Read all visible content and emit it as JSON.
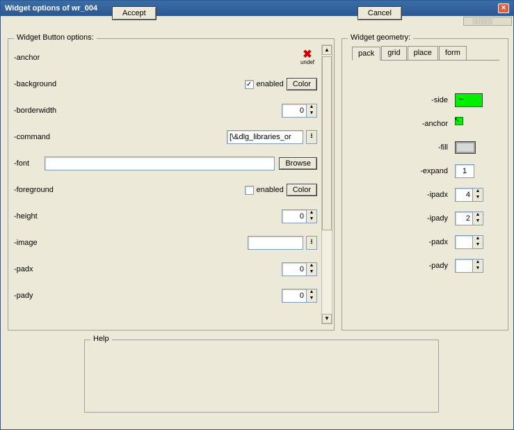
{
  "window": {
    "title": "Widget options of wr_004"
  },
  "buttonOptions": {
    "legend": "Widget Button options:",
    "rows": {
      "anchor": "-anchor",
      "background": "-background",
      "borderwidth": "-borderwidth",
      "command": "-command",
      "font": "-font",
      "foreground": "-foreground",
      "height": "-height",
      "image": "-image",
      "padx": "-padx",
      "pady": "-pady"
    },
    "undef_label": "undef",
    "enabled_label": "enabled",
    "color_btn": "Color",
    "browse_btn": "Browse",
    "values": {
      "background_enabled": true,
      "borderwidth": "0",
      "command": "[\\&dlg_libraries_or",
      "font": "",
      "foreground_enabled": false,
      "height": "0",
      "image": "",
      "padx": "0",
      "pady": "0"
    }
  },
  "geometry": {
    "legend": "Widget geometry:",
    "tabs": [
      "pack",
      "grid",
      "place",
      "form"
    ],
    "active_tab": "pack",
    "rows": {
      "side": "-side",
      "anchor": "-anchor",
      "fill": "-fill",
      "expand": "-expand",
      "ipadx": "-ipadx",
      "ipady": "-ipady",
      "padx": "-padx",
      "pady": "-pady"
    },
    "values": {
      "expand": "1",
      "ipadx": "4",
      "ipady": "2",
      "padx": "",
      "pady": ""
    }
  },
  "help": {
    "legend": "Help"
  },
  "buttons": {
    "accept": "Accept",
    "cancel": "Cancel"
  }
}
